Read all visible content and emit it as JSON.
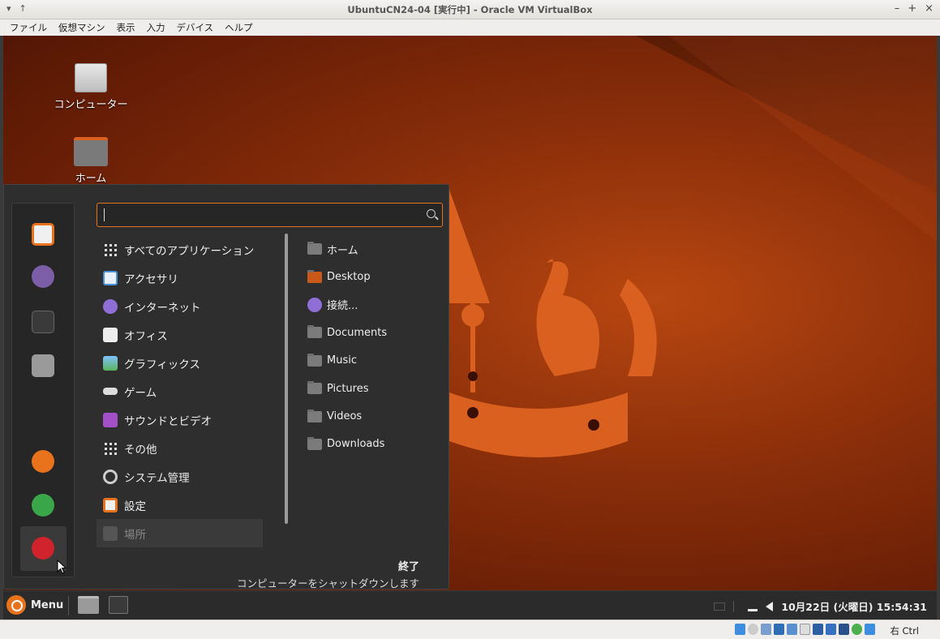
{
  "window": {
    "title": "UbuntuCN24-04 [実行中] - Oracle VM VirtualBox",
    "controls": [
      "▾",
      "↑"
    ],
    "right_controls": [
      "–",
      "+",
      "×"
    ]
  },
  "vbox_menu": [
    "ファイル",
    "仮想マシン",
    "表示",
    "入力",
    "デバイス",
    "ヘルプ"
  ],
  "desktop": {
    "icons": [
      {
        "label": "コンピューター",
        "icon": "computer-icon"
      },
      {
        "label": "ホーム",
        "icon": "home-folder-icon"
      }
    ]
  },
  "start_menu": {
    "search": {
      "value": "",
      "placeholder": ""
    },
    "categories": [
      {
        "label": "すべてのアプリケーション",
        "icon": "grid-icon"
      },
      {
        "label": "アクセサリ",
        "icon": "accessories-icon"
      },
      {
        "label": "インターネット",
        "icon": "internet-icon"
      },
      {
        "label": "オフィス",
        "icon": "office-icon"
      },
      {
        "label": "グラフィックス",
        "icon": "graphics-icon"
      },
      {
        "label": "ゲーム",
        "icon": "games-icon"
      },
      {
        "label": "サウンドとビデオ",
        "icon": "multimedia-icon"
      },
      {
        "label": "その他",
        "icon": "grid-icon"
      },
      {
        "label": "システム管理",
        "icon": "system-icon"
      },
      {
        "label": "設定",
        "icon": "settings-icon"
      },
      {
        "label": "場所",
        "icon": "folder-icon"
      }
    ],
    "places": [
      {
        "label": "ホーム",
        "icon": "home-folder-icon"
      },
      {
        "label": "Desktop",
        "icon": "desktop-folder-icon"
      },
      {
        "label": "接続...",
        "icon": "network-icon"
      },
      {
        "label": "Documents",
        "icon": "documents-folder-icon"
      },
      {
        "label": "Music",
        "icon": "music-folder-icon"
      },
      {
        "label": "Pictures",
        "icon": "pictures-folder-icon"
      },
      {
        "label": "Videos",
        "icon": "videos-folder-icon"
      },
      {
        "label": "Downloads",
        "icon": "downloads-folder-icon"
      }
    ],
    "footer": {
      "title": "終了",
      "description": "コンピューターをシャットダウンします"
    }
  },
  "panel": {
    "menu_label": "Menu",
    "clock": "10月22日 (火曜日) 15:54:31"
  },
  "statusbar": {
    "host_key": "右 Ctrl"
  },
  "colors": {
    "accent": "#e9731c",
    "menu_bg": "#2e2e2e",
    "panel_bg": "#2b2b2b"
  }
}
